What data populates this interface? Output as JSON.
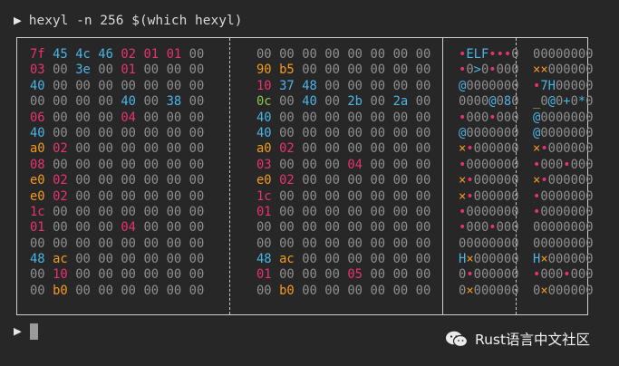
{
  "terminal": {
    "prompt_glyph": "▶",
    "command": "hexyl -n 256 $(which hexyl)",
    "bottom_prompt_glyph": "▶"
  },
  "watermark": {
    "text": "Rust语言中文社区",
    "icon": "wechat-icon"
  },
  "colors": {
    "background": "#272727",
    "null_byte": "#8f8f8f",
    "ascii_printable": "#4bb4e6",
    "ascii_whitespace": "#8ec84a",
    "non_ascii": "#f59a1f",
    "other": "#e8336f"
  },
  "hexdump": {
    "rows": [
      {
        "hex1": "7f 45 4c 46 02 01 01 00",
        "hex2": "00 00 00 00 00 00 00 00",
        "ascii1": "•ELF•••0",
        "ascii2": "00000000"
      },
      {
        "hex1": "03 00 3e 00 01 00 00 00",
        "hex2": "90 b5 00 00 00 00 00 00",
        "ascii1": "•0>0•000",
        "ascii2": "××000000"
      },
      {
        "hex1": "40 00 00 00 00 00 00 00",
        "hex2": "10 37 48 00 00 00 00 00",
        "ascii1": "@0000000",
        "ascii2": "•7H00000"
      },
      {
        "hex1": "00 00 00 00 40 00 38 00",
        "hex2": "0c 00 40 00 2b 00 2a 00",
        "ascii1": "0000@080",
        "ascii2": "_0@0+0*0"
      },
      {
        "hex1": "06 00 00 00 04 00 00 00",
        "hex2": "40 00 00 00 00 00 00 00",
        "ascii1": "•000•000",
        "ascii2": "@0000000"
      },
      {
        "hex1": "40 00 00 00 00 00 00 00",
        "hex2": "40 00 00 00 00 00 00 00",
        "ascii1": "@0000000",
        "ascii2": "@0000000"
      },
      {
        "hex1": "a0 02 00 00 00 00 00 00",
        "hex2": "a0 02 00 00 00 00 00 00",
        "ascii1": "×•000000",
        "ascii2": "×•000000"
      },
      {
        "hex1": "08 00 00 00 00 00 00 00",
        "hex2": "03 00 00 00 04 00 00 00",
        "ascii1": "•0000000",
        "ascii2": "•000•000"
      },
      {
        "hex1": "e0 02 00 00 00 00 00 00",
        "hex2": "e0 02 00 00 00 00 00 00",
        "ascii1": "×•000000",
        "ascii2": "×•000000"
      },
      {
        "hex1": "e0 02 00 00 00 00 00 00",
        "hex2": "1c 00 00 00 00 00 00 00",
        "ascii1": "×•000000",
        "ascii2": "•0000000"
      },
      {
        "hex1": "1c 00 00 00 00 00 00 00",
        "hex2": "01 00 00 00 00 00 00 00",
        "ascii1": "•0000000",
        "ascii2": "•0000000"
      },
      {
        "hex1": "01 00 00 00 04 00 00 00",
        "hex2": "00 00 00 00 00 00 00 00",
        "ascii1": "•000•000",
        "ascii2": "00000000"
      },
      {
        "hex1": "00 00 00 00 00 00 00 00",
        "hex2": "00 00 00 00 00 00 00 00",
        "ascii1": "00000000",
        "ascii2": "00000000"
      },
      {
        "hex1": "48 ac 00 00 00 00 00 00",
        "hex2": "48 ac 00 00 00 00 00 00",
        "ascii1": "H×000000",
        "ascii2": "H×000000"
      },
      {
        "hex1": "00 10 00 00 00 00 00 00",
        "hex2": "01 00 00 00 05 00 00 00",
        "ascii1": "0•000000",
        "ascii2": "•000•000"
      },
      {
        "hex1": "00 b0 00 00 00 00 00 00",
        "hex2": "00 b0 00 00 00 00 00 00",
        "ascii1": "0×000000",
        "ascii2": "0×000000"
      }
    ]
  }
}
